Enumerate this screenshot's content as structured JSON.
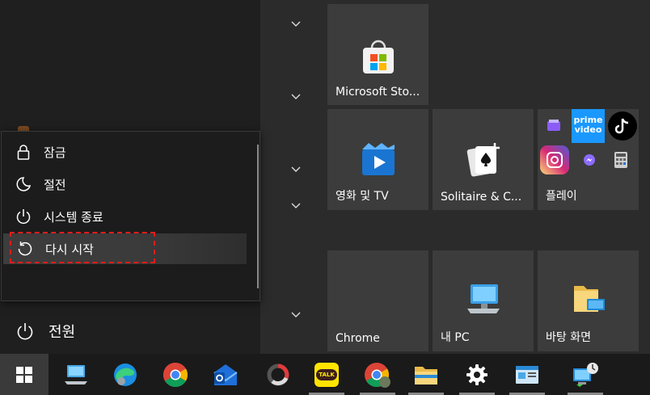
{
  "tiles": {
    "store": "Microsoft Sto...",
    "movies": "영화 및 TV",
    "solitaire": "Solitaire & C...",
    "play": "플레이",
    "chrome": "Chrome",
    "mypc": "내 PC",
    "desktop": "바탕 화면",
    "prime_text_1": "prime",
    "prime_text_2": "video"
  },
  "power_menu": {
    "items": [
      {
        "label": "잠금",
        "icon": "lock-icon"
      },
      {
        "label": "절전",
        "icon": "moon-icon"
      },
      {
        "label": "시스템 종료",
        "icon": "power-icon"
      },
      {
        "label": "다시 시작",
        "icon": "restart-icon"
      }
    ],
    "highlighted": "다시 시작"
  },
  "power_button": {
    "label": "전원"
  },
  "taskbar": {
    "kakaotalk_badge": "TALK",
    "icons": [
      "windows-start-icon",
      "network-pc-icon",
      "edge-icon",
      "chrome-icon",
      "mail-icon",
      "app-ring-icon",
      "kakaotalk-icon",
      "chrome-profile-icon",
      "file-explorer-icon",
      "settings-gear-icon",
      "control-panel-icon",
      "remote-desktop-icon"
    ]
  },
  "colors": {
    "accent_focus": "#e21c1c",
    "tile_bg": "#3c3c3c",
    "taskbar_bg": "#1a1a1a"
  }
}
